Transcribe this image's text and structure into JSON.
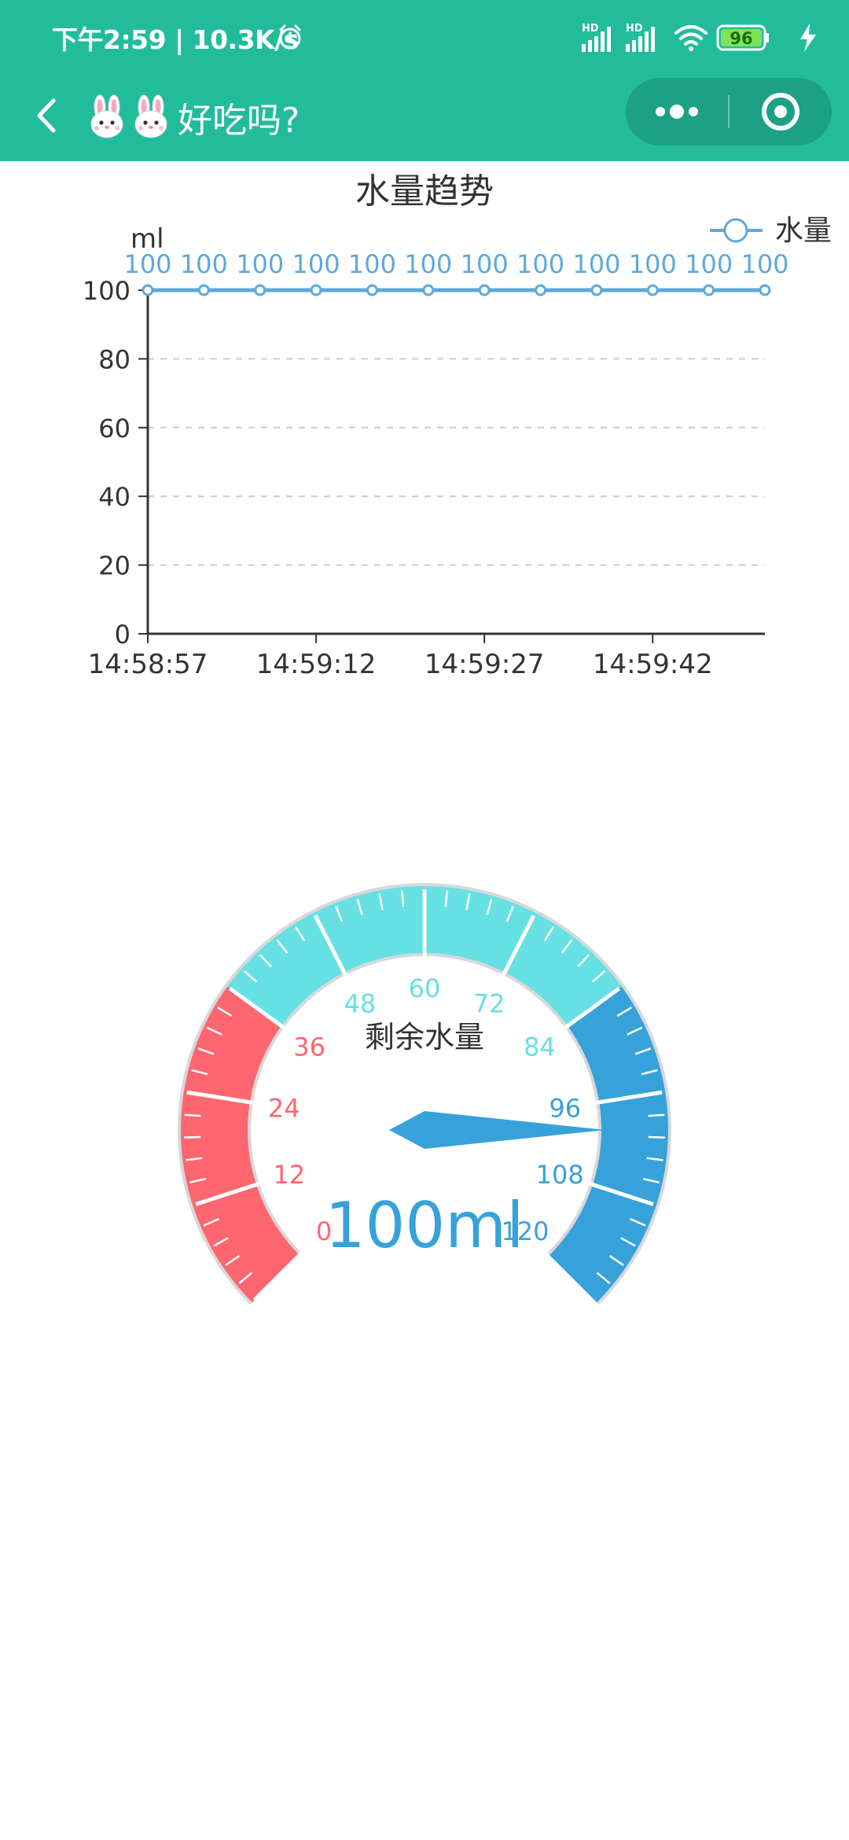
{
  "status_bar": {
    "time_speed": "下午2:59 | 10.3K/s",
    "network_1": "HD",
    "network_2": "HD",
    "battery": "96",
    "icons": [
      "alarm-icon",
      "signal-icon",
      "signal-icon",
      "wifi-icon",
      "battery-icon",
      "charging-icon"
    ]
  },
  "nav": {
    "title": "好吃吗?",
    "title_emoji": "rabbit-face-icon",
    "back_icon": "chevron-left-icon",
    "more_icon": "more-dots-icon",
    "close_icon": "target-close-icon"
  },
  "colors": {
    "header": "#22bc9c",
    "series": "#5fa8dc",
    "gauge_red": "#fe6670",
    "gauge_cyan": "#67e0e3",
    "gauge_blue": "#37a2da"
  },
  "chart_data": [
    {
      "type": "line",
      "title": "水量趋势",
      "ylabel": "ml",
      "xlabel": "",
      "ylim": [
        0,
        100
      ],
      "yticks": [
        0,
        20,
        40,
        60,
        80,
        100
      ],
      "xtick_labels": [
        "14:58:57",
        "14:59:12",
        "14:59:27",
        "14:59:42"
      ],
      "grid": true,
      "legend": "top-right",
      "series": [
        {
          "name": "水量",
          "values": [
            100,
            100,
            100,
            100,
            100,
            100,
            100,
            100,
            100,
            100,
            100,
            100
          ]
        }
      ],
      "data_labels": true
    },
    {
      "type": "gauge",
      "title": "剩余水量",
      "min": 0,
      "max": 120,
      "value": 100,
      "unit": "ml",
      "value_label": "100ml",
      "tick_labels": [
        "0",
        "12",
        "24",
        "36",
        "48",
        "60",
        "72",
        "84",
        "96",
        "108",
        "120"
      ],
      "bands": [
        {
          "to": 36,
          "color": "#fe6670"
        },
        {
          "to": 84,
          "color": "#67e0e3"
        },
        {
          "to": 120,
          "color": "#37a2da"
        }
      ]
    }
  ]
}
